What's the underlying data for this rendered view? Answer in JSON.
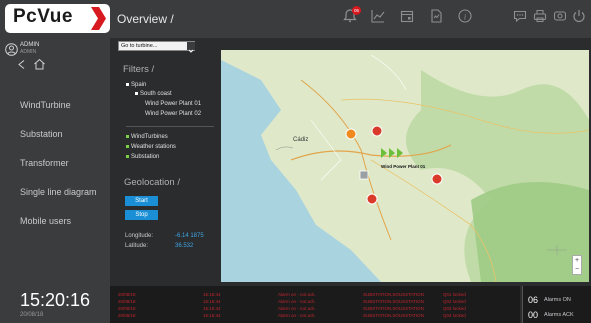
{
  "app": {
    "logo_text": "PcVue",
    "title": "Overview /",
    "alarm_badge": "06"
  },
  "user": {
    "name": "ADMIN",
    "role": "ADMIN"
  },
  "sidebar": {
    "items": [
      "WindTurbine",
      "Substation",
      "Transformer",
      "Single line diagram",
      "Mobile users"
    ]
  },
  "clock": {
    "time": "15:20:16",
    "date": "20/08/18"
  },
  "panel": {
    "goto_select": "Go to turbine...",
    "filters_title": "Filters /",
    "tree": {
      "country": "Spain",
      "region": "South coast",
      "plant1": "Wind Power Plant 01",
      "plant2": "Wind Power Plant 02"
    },
    "layers": [
      "WindTurbines",
      "Weather stations",
      "Substation"
    ],
    "geo_title": "Geolocation /",
    "start_label": "Start",
    "stop_label": "Stop",
    "longitude_label": "Longitude:",
    "longitude_value": "-6.14 1875",
    "latitude_label": "Latitude:",
    "latitude_value": "36.532"
  },
  "map": {
    "label_plant": "Wind Power Plant 01",
    "place_cadiz": "Cádiz"
  },
  "alarms": {
    "rows": [
      {
        "date": "20/08/18",
        "time": "15:16:44",
        "state": "Alarm on - not ack.",
        "source": "SUBSTATION.SOUSSTATION",
        "msg": "Q01 locked"
      },
      {
        "date": "20/08/18",
        "time": "15:16:44",
        "state": "Alarm on - not ack.",
        "source": "SUBSTATION.SOUSSTATION",
        "msg": "Q02 locked"
      },
      {
        "date": "20/08/18",
        "time": "15:16:44",
        "state": "Alarm on - not ack.",
        "source": "SUBSTATION.SOUSSTATION",
        "msg": "Q03 locked"
      },
      {
        "date": "20/08/18",
        "time": "15:16:44",
        "state": "Alarm on - not ack.",
        "source": "SUBSTATION.SOUSSTATION",
        "msg": "Q04 locked"
      }
    ],
    "on_count": "06",
    "on_label": "Alarms ON",
    "ack_count": "00",
    "ack_label": "Alarms ACK"
  },
  "colors": {
    "accent": "#1a8fd6",
    "alarm_red": "#c0262d",
    "logo_red": "#d71920",
    "link_blue": "#3ea6e6"
  }
}
